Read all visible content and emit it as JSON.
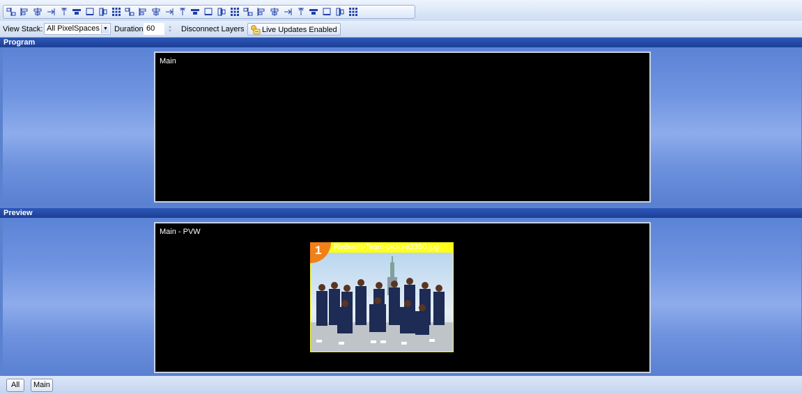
{
  "toolbar": {
    "icons": [
      "align-grid-icon",
      "align-left-edges-icon",
      "align-centers-icon",
      "align-right-edges-icon",
      "distribute-horizontal-icon",
      "center-horizontal-icon",
      "space-horizontal-icon",
      "move-right-icon",
      "move-left-icon",
      "move-top-icon",
      "move-bottom-icon",
      "align-top-icon",
      "align-middle-icon",
      "align-bottom-icon",
      "align-vertical-box-icon",
      "distribute-vertical-icon",
      "center-vertical-icon",
      "stack-vertical-icon",
      "stack-horizontal-icon",
      "tile-horizontal-icon",
      "tile-vertical-icon",
      "tile-grid-icon",
      "horizontal-spacer-icon",
      "vertical-spacer-icon",
      "fit-width-icon",
      "fit-height-icon",
      "grid-layout-icon"
    ]
  },
  "options": {
    "view_stack_label": "View Stack:",
    "view_stack_value": "All PixelSpaces",
    "duration_label": "Duration:",
    "duration_value": "60",
    "disconnect_label": "Disconnect Layers",
    "live_updates_label": "Live Updates Enabled"
  },
  "program": {
    "header": "Program",
    "monitor_label": "Main"
  },
  "preview": {
    "header": "Preview",
    "monitor_label": "Main - PVW",
    "layer": {
      "number": "1",
      "title": "Redeem-Team-picture2350.jpg"
    }
  },
  "bottom": {
    "all_label": "All",
    "main_label": "Main"
  },
  "colors": {
    "header_blue": "#1c3f95",
    "layer_yellow": "#ffff1a",
    "layer_orange": "#f08018"
  }
}
